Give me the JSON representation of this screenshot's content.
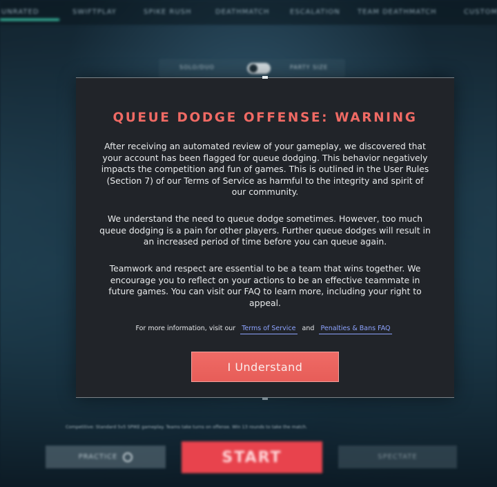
{
  "background": {
    "nav_tabs": [
      "UNRATED",
      "SWIFTPLAY",
      "SPIKE RUSH",
      "DEATHMATCH",
      "ESCALATION",
      "TEAM DEATHMATCH",
      "CUSTOM"
    ],
    "sub_tabs": [
      "SOLO/DUO",
      "PARTY SIZE"
    ],
    "note": "Competitive: Standard 5v5 SPIKE gameplay. Teams take turns on offense. Win 13 rounds to take the match.",
    "practice_label": "PRACTICE",
    "start_label": "START",
    "right_button_label": "SPECTATE"
  },
  "modal": {
    "title": "QUEUE DODGE OFFENSE: WARNING",
    "paragraph_1": "After receiving an automated review of your gameplay, we discovered that your account has been flagged for queue dodging. This behavior negatively impacts the competition and fun of games. This is outlined in the User Rules (Section 7) of our Terms of Service as harmful to the integrity and spirit of our community.",
    "paragraph_2": "We understand the need to queue dodge sometimes. However, too much queue dodging is a pain for other players. Further queue dodges will result in an increased period of time before you can queue again.",
    "paragraph_3": "Teamwork and respect are essential to be a team that wins together. We encourage you to reflect on your actions to be an effective teammate in future games. You can visit our FAQ to learn more, including your right to appeal.",
    "more_info_prefix": "For more information, visit our",
    "terms_link": "Terms of Service",
    "and_text": "and",
    "faq_link": "Penalties & Bans FAQ",
    "button_label": "I Understand"
  },
  "colors": {
    "title_red": "#f06a64",
    "button_red": "#e75d58",
    "link_blue": "#8ea4ff",
    "modal_bg": "#212429",
    "start_red": "#e8434d",
    "nav_accent": "#3fd1b1"
  }
}
